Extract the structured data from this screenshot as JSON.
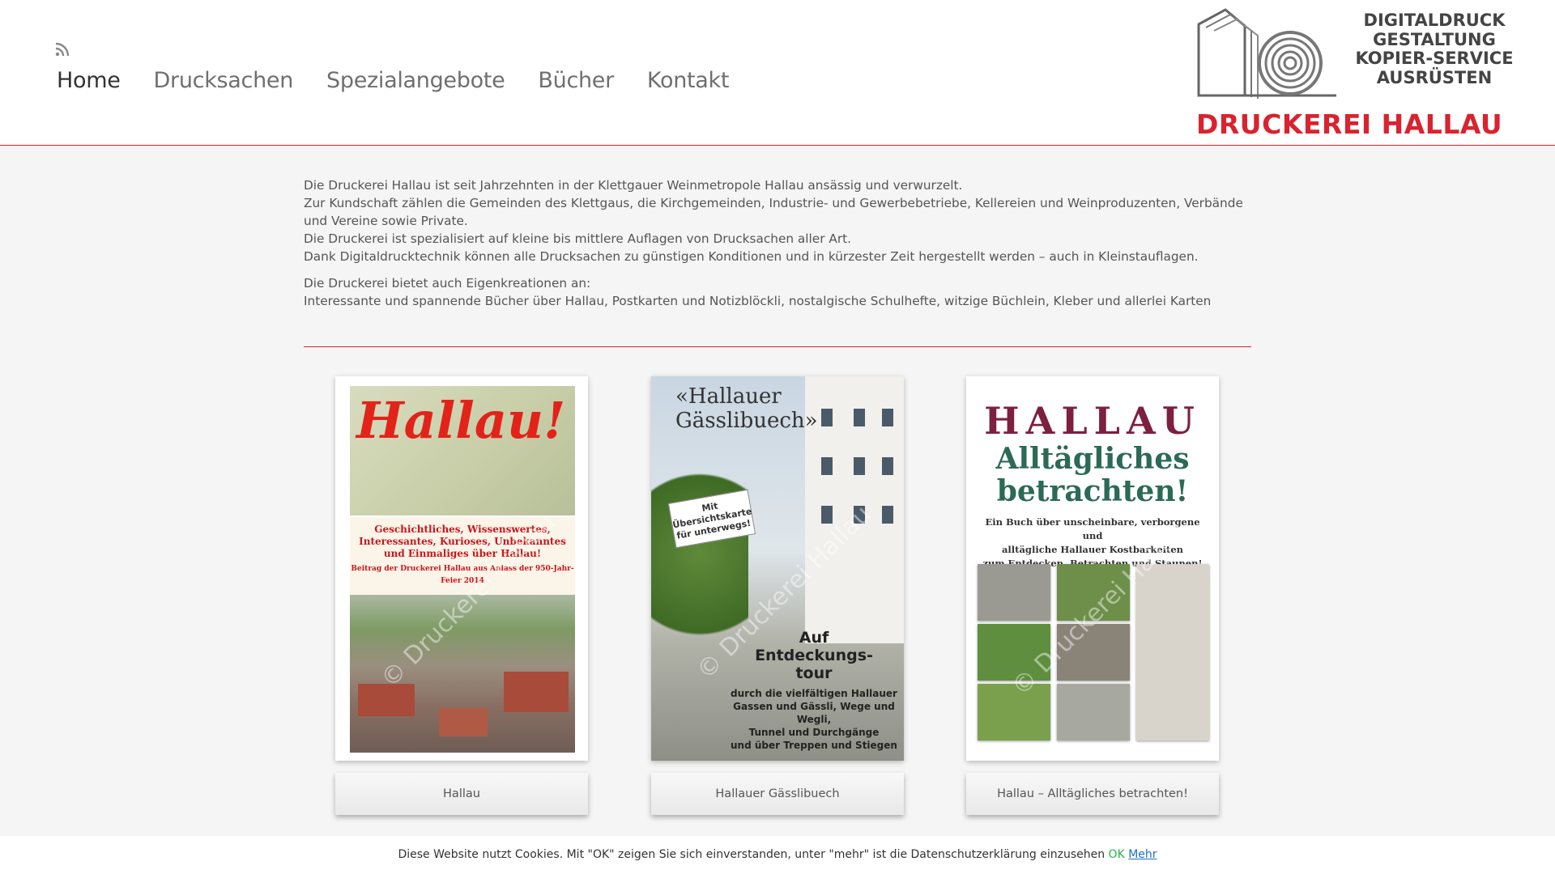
{
  "nav": {
    "items": [
      "Home",
      "Drucksachen",
      "Spezialangebote",
      "Bücher",
      "Kontakt"
    ]
  },
  "logo": {
    "lines": [
      "DIGITALDRUCK",
      "GESTALTUNG",
      "KOPIER-SERVICE",
      "AUSRÜSTEN"
    ],
    "brand": "DRUCKEREI HALLAU"
  },
  "intro": {
    "p1": [
      "Die Druckerei Hallau ist seit Jahrzehnten in der Klettgauer Weinmetropole Hallau ansässig und verwurzelt.",
      "Zur Kundschaft zählen die Gemeinden des Klettgaus, die Kirchgemeinden, Industrie- und Gewerbebetriebe, Kellereien und Weinproduzenten, Verbände und Vereine sowie Private.",
      "Die Druckerei ist spezialisiert auf kleine bis mittlere Auflagen von Drucksachen aller Art.",
      "Dank Digitaldrucktechnik können alle Drucksachen zu günstigen Konditionen und in kürzester Zeit hergestellt werden – auch in Kleinstauflagen."
    ],
    "p2": [
      "Die Druckerei bietet auch Eigenkreationen an:",
      "Interessante und spannende Bücher über Hallau, Postkarten und Notizblöckli, nostalgische Schulhefte, witzige Büchlein, Kleber und allerlei Karten"
    ]
  },
  "books": [
    {
      "caption": "Hallau",
      "cover_title": "Hallau!",
      "cover_text": [
        "Geschichtliches, Wissenswertes,",
        "Interessantes, Kurioses, Unbekanntes",
        "und Einmaliges über Hallau!",
        "Beitrag der Druckerei Hallau aus Anlass der 950-Jahr-Feier 2014"
      ]
    },
    {
      "caption": "Hallauer Gässlibuech",
      "cover_title": [
        "«Hallauer",
        "Gässlibuech»"
      ],
      "stamp": [
        "Mit",
        "Übersichtskarte",
        "für unterwegs!"
      ],
      "big": [
        "Auf",
        "Entdeckungs-",
        "tour"
      ],
      "small": [
        "durch die vielfältigen Hallauer",
        "Gassen und Gässli, Wege und Wegli,",
        "Tunnel und Durchgänge",
        "und über Treppen und Stiegen"
      ]
    },
    {
      "caption": "Hallau – Alltägliches betrachten!",
      "cover_title": "HALLAU",
      "cover_sub": [
        "Alltägliches",
        "betrachten!"
      ],
      "cover_desc": [
        "Ein Buch über unscheinbare, verborgene und",
        "alltägliche Hallauer Kostbarkeiten",
        "zum Entdecken, Betrachten und Staunen!"
      ]
    }
  ],
  "cookie": {
    "text": "Diese Website nutzt Cookies. Mit \"OK\" zeigen Sie sich einverstanden, unter \"mehr\" ist die Datenschutzerklärung einzusehen",
    "ok": "OK",
    "more": "Mehr"
  },
  "colors": {
    "accent": "#d9232e",
    "ok": "#2cb14a",
    "link": "#1e6fc9"
  },
  "icons": {
    "feed": "rss-icon"
  }
}
